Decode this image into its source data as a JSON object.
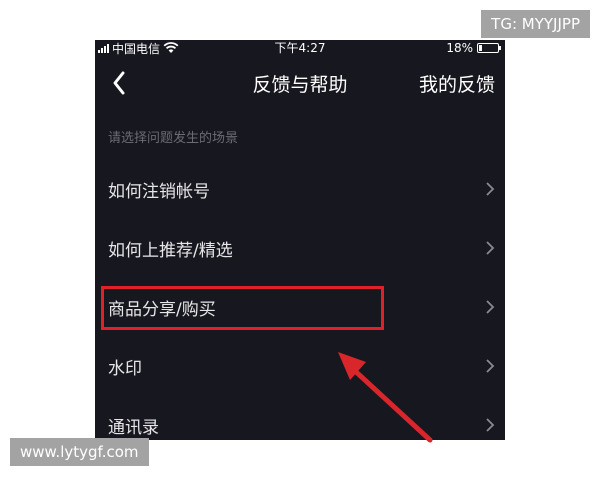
{
  "status_bar": {
    "carrier": "中国电信",
    "time": "下午4:27",
    "battery_percent": "18%",
    "battery_level": 0.18
  },
  "nav": {
    "title": "反馈与帮助",
    "right_label": "我的反馈"
  },
  "section": {
    "label": "请选择问题发生的场景"
  },
  "menu_items": [
    {
      "label": "如何注销帐号"
    },
    {
      "label": "如何上推荐/精选"
    },
    {
      "label": "商品分享/购买"
    },
    {
      "label": "水印"
    },
    {
      "label": "通讯录"
    }
  ],
  "watermarks": {
    "top": "TG: MYYJJPP",
    "bottom": "www.lytygf.com"
  },
  "colors": {
    "screen_bg": "#17171f",
    "highlight": "#e0202a",
    "arrow": "#d8262b"
  }
}
